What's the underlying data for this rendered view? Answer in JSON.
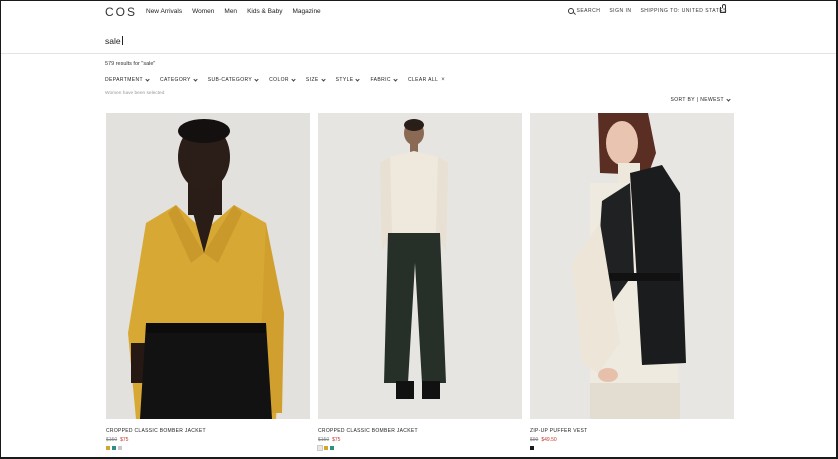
{
  "header": {
    "logo": "COS",
    "nav": [
      "New Arrivals",
      "Women",
      "Men",
      "Kids & Baby",
      "Magazine"
    ],
    "search_label": "SEARCH",
    "signin_label": "SIGN IN",
    "shipping_label": "SHIPPING TO: UNITED STATES"
  },
  "search": {
    "value": "sale"
  },
  "results_text": "579 results for \"sale\"",
  "filters": [
    "DEPARTMENT",
    "CATEGORY",
    "SUB-CATEGORY",
    "COLOR",
    "SIZE",
    "STYLE",
    "FABRIC"
  ],
  "clear_all": "CLEAR ALL",
  "selected_note": "Women have been selected",
  "sort_label": "SORT BY | NEWEST",
  "products": [
    {
      "name": "CROPPED CLASSIC BOMBER JACKET",
      "old_price": "$150",
      "new_price": "$75",
      "swatches": [
        "#d4a52f",
        "#2f8f86",
        "#c9c9c9"
      ]
    },
    {
      "name": "CROPPED CLASSIC BOMBER JACKET",
      "old_price": "$150",
      "new_price": "$75",
      "swatches": [
        "#ece7dd",
        "#d4a52f",
        "#2f8f86"
      ]
    },
    {
      "name": "ZIP-UP PUFFER VEST",
      "old_price": "$99",
      "new_price": "$49.50",
      "swatches": [
        "#1a1a1a"
      ]
    }
  ],
  "colors": {
    "sale_red": "#c0392b",
    "text": "#222222"
  }
}
